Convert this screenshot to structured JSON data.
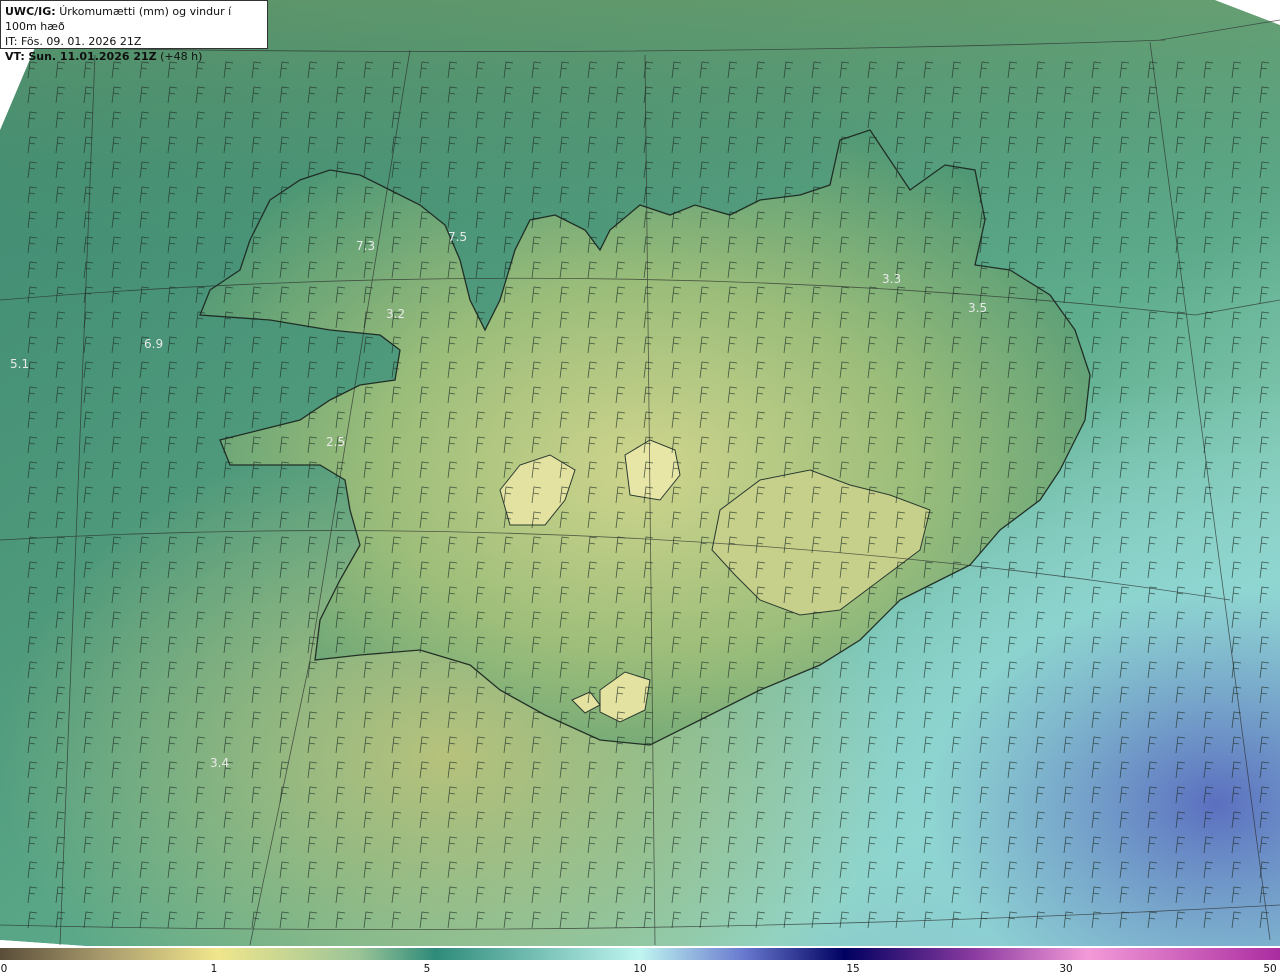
{
  "header": {
    "model_label": "UWC/IG:",
    "title": "Úrkomumætti (mm) og vindur í 100m hæð",
    "it_label": "IT:",
    "issued": "Fös. 09. 01. 2026 21Z",
    "vt_label": "VT:",
    "valid_bold": "Sun. 11.01.2026 21Z",
    "lead": "(+48 h)"
  },
  "map_labels": [
    {
      "id": "label-1",
      "text": "5.1"
    },
    {
      "id": "label-2",
      "text": "6.9"
    },
    {
      "id": "label-3",
      "text": "3.2"
    },
    {
      "id": "label-4",
      "text": "7.3"
    },
    {
      "id": "label-5",
      "text": "7.5"
    },
    {
      "id": "label-6",
      "text": "2.5"
    },
    {
      "id": "label-7",
      "text": "3.4"
    },
    {
      "id": "label-8",
      "text": "3.3"
    },
    {
      "id": "label-9",
      "text": "3.5"
    }
  ],
  "colorbar": {
    "ticks": [
      "0",
      "1",
      "5",
      "10",
      "15",
      "30",
      "50"
    ],
    "colors": [
      "#5a4e3a",
      "#a89a6c",
      "#f0e68c",
      "#9bc497",
      "#2e8b7a",
      "#bff5f0",
      "#2b2a9c",
      "#000060",
      "#8a3aa0",
      "#f39ad8",
      "#aa2ca0"
    ]
  }
}
